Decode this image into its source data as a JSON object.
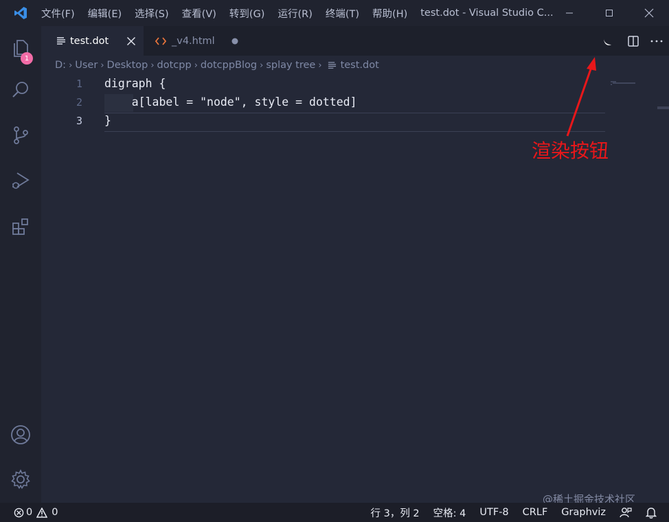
{
  "menu": [
    "文件(F)",
    "编辑(E)",
    "选择(S)",
    "查看(V)",
    "转到(G)",
    "运行(R)",
    "终端(T)",
    "帮助(H)"
  ],
  "window_title": "test.dot - Visual Studio C...",
  "activity": {
    "explorer_badge": "1"
  },
  "tabs": [
    {
      "label": "test.dot",
      "icon": "file-lines-icon",
      "state": "active"
    },
    {
      "label": "_v4.html",
      "icon": "html-brackets-icon",
      "state": "modified"
    }
  ],
  "breadcrumb": [
    "D:",
    "User",
    "Desktop",
    "dotcpp",
    "dotcppBlog",
    "splay tree",
    "test.dot"
  ],
  "editor": {
    "lines": [
      {
        "number": "1",
        "text": "digraph {"
      },
      {
        "number": "2",
        "text": "    a[label = \"node\", style = dotted]"
      },
      {
        "number": "3",
        "text": "}"
      }
    ]
  },
  "annotation": {
    "text": "渲染按钮",
    "color": "#e8171a"
  },
  "watermark": "@稀土掘金技术社区",
  "status": {
    "errors": "0",
    "warnings": "0",
    "position": "行 3，列 2",
    "indent": "空格: 4",
    "encoding": "UTF-8",
    "eol": "CRLF",
    "language": "Graphviz"
  },
  "colors": {
    "accent": "#3a8ee6",
    "badge": "#f26ca7",
    "html_icon": "#e8743b",
    "background": "#242837"
  }
}
